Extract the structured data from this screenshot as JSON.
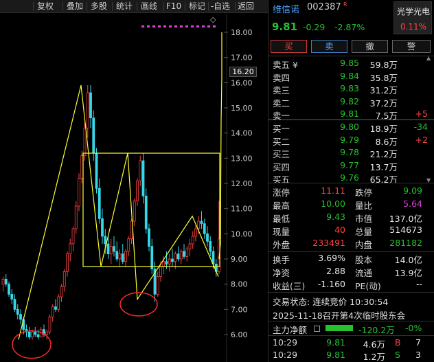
{
  "toolbar": {
    "items": [
      "复权",
      "叠加",
      "多股",
      "统计",
      "画线",
      "F10",
      "标记",
      "-自选",
      "返回"
    ]
  },
  "chart": {
    "price_levels": [
      "18.00",
      "17.00",
      "16.00",
      "15.00",
      "14.00",
      "13.00",
      "12.00",
      "11.00",
      "10.00",
      "9.00",
      "8.00",
      "7.00",
      "6.00"
    ],
    "price_tag": "16.20",
    "diamond_icon": "◇",
    "close_icon": "×"
  },
  "chart_data": {
    "type": "candlestick",
    "ylim": [
      5.5,
      18.3
    ],
    "candles": [
      [
        8.0,
        8.3,
        7.7,
        8.2
      ],
      [
        8.2,
        8.4,
        7.9,
        8.0
      ],
      [
        8.0,
        8.1,
        7.5,
        7.6
      ],
      [
        7.6,
        7.8,
        7.2,
        7.4
      ],
      [
        7.4,
        7.6,
        6.9,
        7.0
      ],
      [
        7.0,
        7.2,
        6.6,
        6.8
      ],
      [
        6.8,
        7.0,
        6.4,
        6.6
      ],
      [
        6.6,
        6.7,
        6.0,
        6.2
      ],
      [
        6.2,
        6.4,
        5.9,
        6.1
      ],
      [
        6.1,
        6.3,
        5.8,
        5.9
      ],
      [
        5.9,
        6.2,
        5.8,
        6.1
      ],
      [
        6.1,
        6.3,
        5.9,
        6.0
      ],
      [
        6.0,
        6.2,
        5.8,
        5.9
      ],
      [
        5.9,
        6.3,
        5.9,
        6.2
      ],
      [
        6.2,
        6.4,
        5.9,
        6.0
      ],
      [
        6.0,
        6.2,
        5.8,
        6.1
      ],
      [
        6.1,
        6.8,
        6.0,
        6.7
      ],
      [
        6.7,
        7.2,
        6.5,
        7.1
      ],
      [
        7.1,
        7.4,
        6.9,
        7.0
      ],
      [
        7.0,
        7.6,
        6.9,
        7.5
      ],
      [
        7.5,
        8.0,
        7.3,
        7.9
      ],
      [
        7.9,
        8.6,
        7.7,
        8.5
      ],
      [
        8.5,
        9.3,
        8.3,
        9.2
      ],
      [
        9.2,
        9.8,
        8.9,
        9.6
      ],
      [
        9.6,
        10.3,
        9.3,
        10.2
      ],
      [
        10.2,
        11.3,
        10.0,
        11.1
      ],
      [
        11.1,
        12.4,
        10.9,
        12.2
      ],
      [
        12.2,
        13.3,
        12.0,
        13.1
      ],
      [
        13.1,
        14.4,
        12.9,
        14.2
      ],
      [
        14.2,
        15.9,
        13.8,
        15.6
      ],
      [
        15.6,
        15.9,
        14.2,
        14.6
      ],
      [
        14.6,
        14.9,
        12.9,
        13.2
      ],
      [
        13.2,
        13.4,
        11.6,
        11.8
      ],
      [
        11.8,
        12.2,
        10.4,
        10.6
      ],
      [
        10.6,
        11.0,
        9.6,
        9.9
      ],
      [
        9.9,
        10.2,
        9.2,
        9.6
      ],
      [
        9.6,
        9.9,
        9.0,
        9.2
      ],
      [
        9.2,
        9.8,
        8.8,
        9.5
      ],
      [
        9.5,
        9.9,
        9.1,
        9.3
      ],
      [
        9.3,
        9.7,
        8.9,
        9.0
      ],
      [
        9.0,
        9.4,
        8.7,
        9.2
      ],
      [
        9.2,
        9.6,
        8.8,
        8.9
      ],
      [
        8.9,
        9.4,
        8.7,
        9.3
      ],
      [
        9.3,
        9.9,
        9.1,
        9.8
      ],
      [
        9.8,
        10.6,
        9.6,
        10.5
      ],
      [
        10.5,
        11.4,
        10.3,
        11.3
      ],
      [
        11.3,
        12.2,
        11.1,
        12.1
      ],
      [
        12.1,
        13.1,
        11.9,
        12.9
      ],
      [
        12.9,
        13.2,
        11.2,
        11.5
      ],
      [
        11.5,
        11.8,
        10.0,
        10.2
      ],
      [
        10.2,
        10.4,
        9.3,
        9.5
      ],
      [
        9.5,
        9.8,
        8.4,
        8.6
      ],
      [
        8.6,
        8.9,
        7.3,
        7.6
      ],
      [
        7.6,
        8.5,
        7.5,
        8.3
      ],
      [
        8.3,
        8.9,
        8.1,
        8.7
      ],
      [
        8.7,
        9.1,
        8.4,
        8.9
      ],
      [
        8.9,
        9.3,
        8.6,
        8.8
      ],
      [
        8.8,
        9.2,
        8.5,
        9.0
      ],
      [
        9.0,
        9.4,
        8.7,
        8.9
      ],
      [
        8.9,
        9.3,
        8.6,
        9.2
      ],
      [
        9.2,
        9.5,
        8.9,
        9.0
      ],
      [
        9.0,
        9.4,
        8.8,
        9.3
      ],
      [
        9.3,
        9.6,
        9.0,
        9.1
      ],
      [
        9.1,
        9.5,
        8.9,
        9.4
      ],
      [
        9.4,
        9.8,
        9.1,
        9.6
      ],
      [
        9.6,
        10.1,
        9.4,
        9.9
      ],
      [
        9.9,
        10.4,
        9.7,
        10.2
      ],
      [
        10.2,
        10.7,
        10.0,
        10.5
      ],
      [
        10.5,
        10.9,
        10.2,
        10.4
      ],
      [
        10.4,
        10.6,
        9.8,
        10.0
      ],
      [
        10.0,
        10.3,
        9.5,
        9.7
      ],
      [
        9.7,
        9.9,
        9.1,
        9.3
      ],
      [
        9.3,
        9.5,
        8.6,
        8.8
      ],
      [
        8.8,
        9.0,
        8.3,
        8.5
      ],
      [
        8.5,
        11.3,
        8.4,
        9.8
      ]
    ],
    "intraday_line": [
      [
        9.0,
        9.1
      ],
      [
        14.5,
        16.2
      ],
      [
        18.0
      ]
    ],
    "annotation_lines": "yellow zigzag, rectangle 8.7-13.2, two red ellipses at lows"
  },
  "quote": {
    "name": "维信诺",
    "code": "002387",
    "badge": "R",
    "price": "9.81",
    "change": "-0.29",
    "change_pct": "-2.87%",
    "sector_name": "光学光电",
    "sector_pct": "0.11%"
  },
  "buttons": {
    "buy": "买",
    "sell": "卖",
    "cancel": "撤",
    "alert": "警"
  },
  "asks": [
    {
      "label": "卖五 ¥",
      "price": "9.85",
      "vol": "59.8万",
      "delta": ""
    },
    {
      "label": "卖四",
      "price": "9.84",
      "vol": "35.8万",
      "delta": ""
    },
    {
      "label": "卖三",
      "price": "9.83",
      "vol": "31.2万",
      "delta": ""
    },
    {
      "label": "卖二",
      "price": "9.82",
      "vol": "37.2万",
      "delta": ""
    },
    {
      "label": "卖一",
      "price": "9.81",
      "vol": "7.5万",
      "delta": "+5"
    }
  ],
  "bids": [
    {
      "label": "买一",
      "price": "9.80",
      "vol": "18.9万",
      "delta": "-34"
    },
    {
      "label": "买二",
      "price": "9.79",
      "vol": "8.6万",
      "delta": "+2"
    },
    {
      "label": "买三",
      "price": "9.78",
      "vol": "21.2万",
      "delta": ""
    },
    {
      "label": "买四",
      "price": "9.77",
      "vol": "13.7万",
      "delta": ""
    },
    {
      "label": "买五",
      "price": "9.76",
      "vol": "65.2万",
      "delta": ""
    }
  ],
  "stats": [
    {
      "l1": "涨停",
      "v1": "11.11",
      "c1": "red",
      "l2": "跌停",
      "v2": "9.09",
      "c2": "green"
    },
    {
      "l1": "最高",
      "v1": "10.00",
      "c1": "green",
      "l2": "量比",
      "v2": "5.64",
      "c2": "magenta"
    },
    {
      "l1": "最低",
      "v1": "9.43",
      "c1": "green",
      "l2": "市值",
      "v2": "137.0亿",
      "c2": "white"
    },
    {
      "l1": "现量",
      "v1": "40",
      "c1": "red",
      "l2": "总量",
      "v2": "514673",
      "c2": "white"
    },
    {
      "l1": "外盘",
      "v1": "233491",
      "c1": "red",
      "l2": "内盘",
      "v2": "281182",
      "c2": "green"
    }
  ],
  "stats2": [
    {
      "l1": "换手",
      "v1": "3.69%",
      "l2": "股本",
      "v2": "14.0亿"
    },
    {
      "l1": "净资",
      "v1": "2.88",
      "l2": "流通",
      "v2": "13.9亿"
    },
    {
      "l1": "收益(三)",
      "v1": "-1.160",
      "l2": "PE(动)",
      "v2": "--"
    }
  ],
  "status": "交易状态: 连续竞价 10:30:54",
  "notice": "2025-11-18召开第4次临时股东会",
  "flow": {
    "label": "主力净额",
    "value": "-120.2万",
    "pct": "-0%"
  },
  "ticks": [
    {
      "time": "10:29",
      "price": "9.81",
      "vol": "4.6万",
      "side": "B",
      "count": "7"
    },
    {
      "time": "10:29",
      "price": "9.81",
      "vol": "1.2万",
      "side": "S",
      "count": "3"
    }
  ],
  "colors": {
    "up": "#ff4242",
    "down": "#27c12f",
    "annot": "#ffff33",
    "accent": "#4aa3ff"
  }
}
